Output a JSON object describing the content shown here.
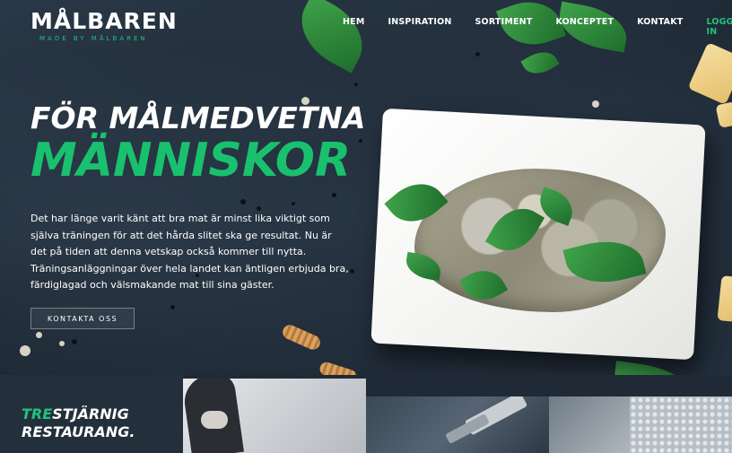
{
  "brand": {
    "name": "MÅLBAREN",
    "tagline": "MADE BY MÅLBAREN"
  },
  "nav": {
    "items": [
      "HEM",
      "INSPIRATION",
      "SORTIMENT",
      "KONCEPTET",
      "KONTAKT"
    ],
    "login": "LOGGA IN"
  },
  "hero": {
    "title_line1": "FÖR MÅLMEDVETNA",
    "title_line2": "MÄNNISKOR",
    "body": "Det har länge varit känt att bra mat är minst lika viktigt som själva träningen för att det hårda slitet ska ge resultat. Nu är det på tiden att denna vetskap också kommer till nytta. Träningsanläggningar över hela landet kan äntligen erbjuda bra, färdiglagad och välsmakande mat till sina gäster.",
    "cta": "KONTAKTA OSS"
  },
  "features": {
    "first_tag_green": "TRE",
    "first_tag_rest": "STJÄRNIG",
    "first_tag_line2": "RESTAURANG."
  },
  "colors": {
    "accent": "#22c27a",
    "background": "#1f2a36"
  }
}
